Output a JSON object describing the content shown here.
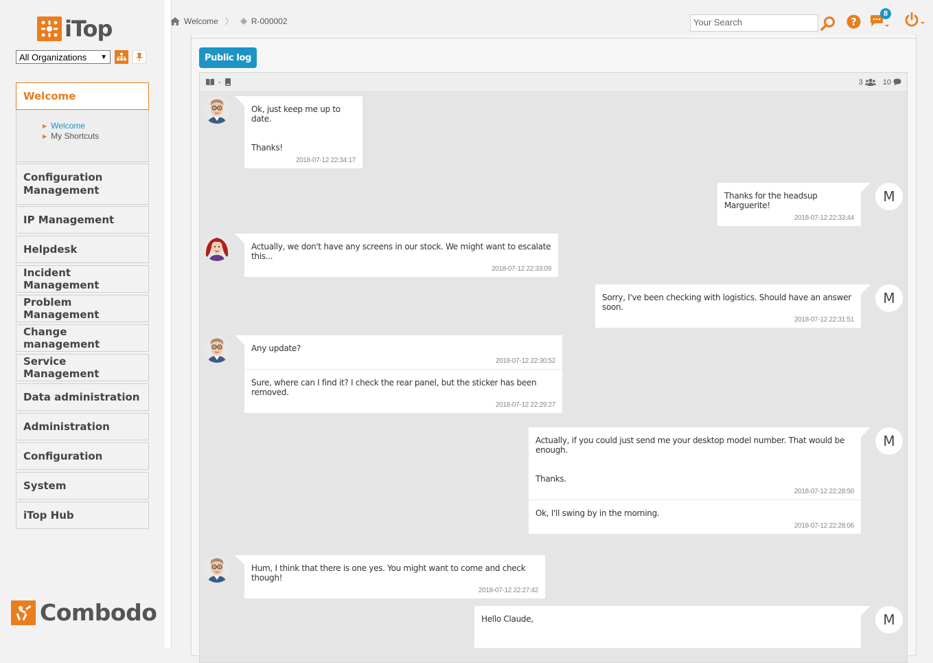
{
  "app": {
    "logo_text": "iTop",
    "org_select_value": "All Organizations",
    "footer_logo_text": "Combodo"
  },
  "colors": {
    "accent": "#ea7d1e",
    "link": "#1c94c4",
    "badge": "#1c94c4"
  },
  "sidebar": {
    "active_menu": "Welcome",
    "submenu": [
      "Welcome",
      "My Shortcuts"
    ],
    "menus": [
      "Configuration Management",
      "IP Management",
      "Helpdesk",
      "Incident Management",
      "Problem Management",
      "Change management",
      "Service Management",
      "Data administration",
      "Administration",
      "Configuration",
      "System",
      "iTop Hub"
    ]
  },
  "header": {
    "breadcrumb": [
      "Welcome",
      "R-000002"
    ],
    "search_placeholder": "Your Search",
    "notification_count": "8"
  },
  "log": {
    "tab_label": "Public log",
    "toolbar_separator": "-",
    "participants_count": "3",
    "messages_count": "10",
    "groups": [
      {
        "side": "left",
        "avatar": "man",
        "entries": [
          {
            "text": "Ok, just keep me up to date.\n\n\nThanks!",
            "date": "2018-07-12 22:34:17"
          }
        ]
      },
      {
        "side": "right",
        "avatar": "M",
        "entries": [
          {
            "text": "Thanks for the headsup Marguerite!",
            "date": "2018-07-12 22:33:44"
          }
        ]
      },
      {
        "side": "left",
        "avatar": "woman",
        "entries": [
          {
            "text": "Actually, we don't have any screens in our stock. We might want to escalate this...",
            "date": "2018-07-12 22:33:09"
          }
        ]
      },
      {
        "side": "right",
        "avatar": "M",
        "entries": [
          {
            "text": "Sorry, I've been checking with logistics. Should have an answer soon.",
            "date": "2018-07-12 22:31:51"
          }
        ]
      },
      {
        "side": "left",
        "avatar": "man",
        "entries": [
          {
            "text": "Any update?",
            "date": "2018-07-12 22:30:52"
          },
          {
            "text": "Sure, where can I find it? I check the rear panel, but the sticker has been removed.",
            "date": "2018-07-12 22:29:27"
          }
        ]
      },
      {
        "side": "right",
        "avatar": "M",
        "entries": [
          {
            "text": "Actually, if you could just send me your desktop model number. That would be enough.\n\n\nThanks.",
            "date": "2018-07-12 22:28:50"
          },
          {
            "text": "Ok, I'll swing by in the morning.",
            "date": "2018-07-12 22:28:06"
          }
        ]
      },
      {
        "side": "left",
        "avatar": "man",
        "entries": [
          {
            "text": "Hum, I think that there is one yes. You might want to come and check though!",
            "date": "2018-07-12 22:27:42"
          }
        ]
      },
      {
        "side": "right",
        "avatar": "M",
        "entries": [
          {
            "text": "Hello Claude,",
            "date": ""
          }
        ]
      }
    ]
  }
}
